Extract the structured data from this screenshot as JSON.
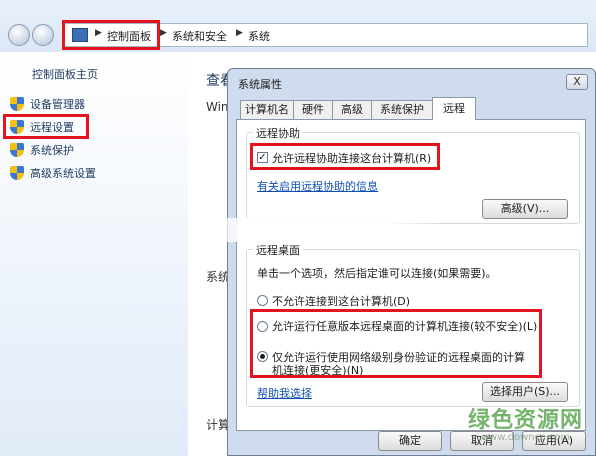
{
  "address_bar": {
    "crumbs": [
      "控制面板",
      "系统和安全",
      "系统"
    ]
  },
  "sidebar": {
    "home": "控制面板主页",
    "items": [
      {
        "label": "设备管理器"
      },
      {
        "label": "远程设置"
      },
      {
        "label": "系统保护"
      },
      {
        "label": "高级系统设置"
      }
    ]
  },
  "main_fragments": {
    "view": "查看",
    "win": "Win",
    "system": "系统",
    "computer": "计算"
  },
  "dialog": {
    "title": "系统属性",
    "close_glyph": "X",
    "tabs": [
      "计算机名",
      "硬件",
      "高级",
      "系统保护",
      "远程"
    ],
    "active_tab": "远程",
    "remote_assistance": {
      "title": "远程协助",
      "checkbox_label": "允许远程协助连接这台计算机(R)",
      "checkbox_checked": true,
      "link": "有关启用远程协助的信息",
      "advanced_button": "高级(V)..."
    },
    "remote_desktop": {
      "title": "远程桌面",
      "instruction": "单击一个选项，然后指定谁可以连接(如果需要)。",
      "options": [
        {
          "label": "不允许连接到这台计算机(D)",
          "selected": false
        },
        {
          "label": "允许运行任意版本远程桌面的计算机连接(较不安全)(L)",
          "selected": false
        },
        {
          "label_line1": "仅允许运行使用网络级别身份验证的远程桌面的计算",
          "label_line2": "机连接(更安全)(N)",
          "selected": true
        }
      ],
      "help_link": "帮助我选择",
      "select_users_button": "选择用户(S)..."
    },
    "buttons": {
      "ok": "确定",
      "cancel": "取消",
      "apply": "应用(A)"
    }
  },
  "watermark": {
    "main": "绿色资源网",
    "sub": "www.downcc.com"
  },
  "colors": {
    "highlight": "#e3141d",
    "link": "#0f4fb4",
    "sidebar_text": "#1e3a5f"
  }
}
